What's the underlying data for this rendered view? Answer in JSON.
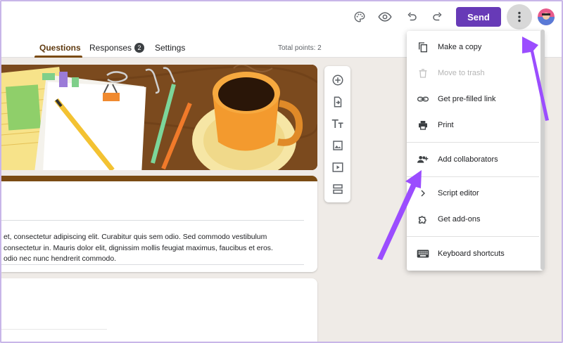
{
  "toolbar": {
    "send_label": "Send",
    "icons": [
      "palette-icon",
      "preview-eye-icon",
      "undo-icon",
      "redo-icon",
      "more-vert-icon",
      "avatar"
    ]
  },
  "tabs": [
    {
      "label": "Questions",
      "active": true
    },
    {
      "label": "Responses",
      "badge": "2"
    },
    {
      "label": "Settings"
    }
  ],
  "total_points": "Total points: 2",
  "form": {
    "description_lines": [
      "et, consectetur adipiscing elit. Curabitur quis sem odio. Sed commodo vestibulum",
      "consectetur in. Mauris dolor elit, dignissim mollis feugiat maximus, faucibus et eros.",
      "odio nec nunc hendrerit commodo."
    ]
  },
  "side_tools": [
    "add-question-icon",
    "import-questions-icon",
    "add-title-icon",
    "add-image-icon",
    "add-video-icon",
    "add-section-icon"
  ],
  "menu": {
    "items": [
      {
        "label": "Make a copy",
        "icon": "copy-icon",
        "enabled": true
      },
      {
        "label": "Move to trash",
        "icon": "trash-icon",
        "enabled": false
      },
      {
        "label": "Get pre-filled link",
        "icon": "link-icon",
        "enabled": true
      },
      {
        "label": "Print",
        "icon": "print-icon",
        "enabled": true
      },
      {
        "label": "Add collaborators",
        "icon": "add-people-icon",
        "enabled": true
      },
      {
        "label": "Script editor",
        "icon": "code-icon",
        "enabled": true
      },
      {
        "label": "Get add-ons",
        "icon": "puzzle-icon",
        "enabled": true
      },
      {
        "label": "Keyboard shortcuts",
        "icon": "keyboard-icon",
        "enabled": true
      }
    ]
  },
  "colors": {
    "accent": "#673ab7",
    "theme": "#7a4b13",
    "annotation_arrow": "#9b4dff"
  }
}
